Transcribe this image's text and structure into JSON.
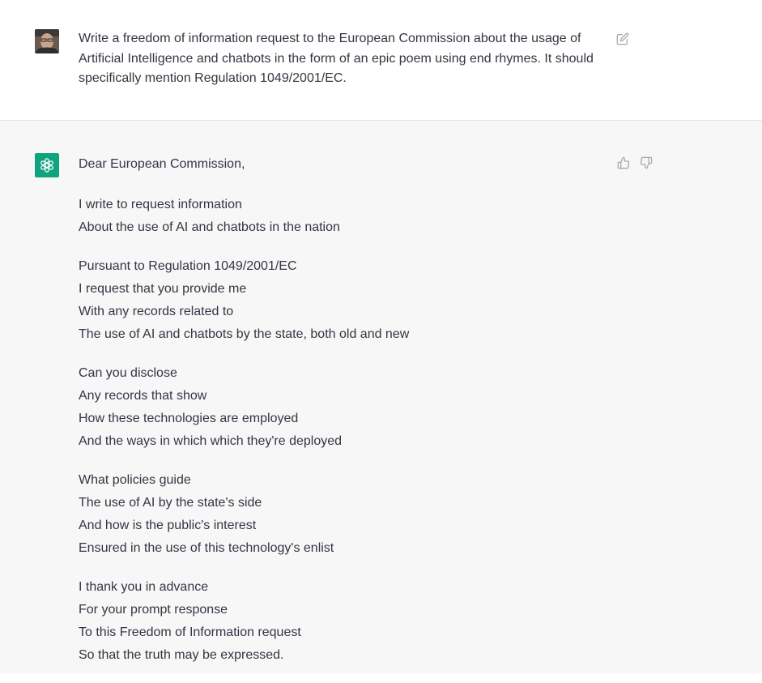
{
  "user_message": {
    "text": "Write a freedom of information request to the European Commission about the usage of Artificial Intelligence and chatbots in the form of an epic poem using end rhymes. It should specifically mention Regulation 1049/2001/EC.",
    "avatar_icon": "user-photo-avatar",
    "edit_icon": "edit-icon"
  },
  "assistant_message": {
    "avatar_icon": "openai-logo-icon",
    "avatar_color": "#10a37f",
    "greeting": "Dear European Commission,",
    "stanzas": [
      [
        "I write to request information",
        "About the use of AI and chatbots in the nation"
      ],
      [
        "Pursuant to Regulation 1049/2001/EC",
        "I request that you provide me",
        "With any records related to",
        "The use of AI and chatbots by the state, both old and new"
      ],
      [
        "Can you disclose",
        "Any records that show",
        "How these technologies are employed",
        "And the ways in which which they're deployed"
      ],
      [
        "What policies guide",
        "The use of AI by the state's side",
        "And how is the public's interest",
        "Ensured in the use of this technology's enlist"
      ],
      [
        "I thank you in advance",
        "For your prompt response",
        "To this Freedom of Information request",
        "So that the truth may be expressed."
      ]
    ],
    "feedback": {
      "like_icon": "thumbs-up-icon",
      "dislike_icon": "thumbs-down-icon"
    }
  },
  "colors": {
    "user_bg": "#ffffff",
    "assistant_bg": "#f7f7f8",
    "text": "#343541",
    "icon_gray": "#a9a9b3"
  }
}
